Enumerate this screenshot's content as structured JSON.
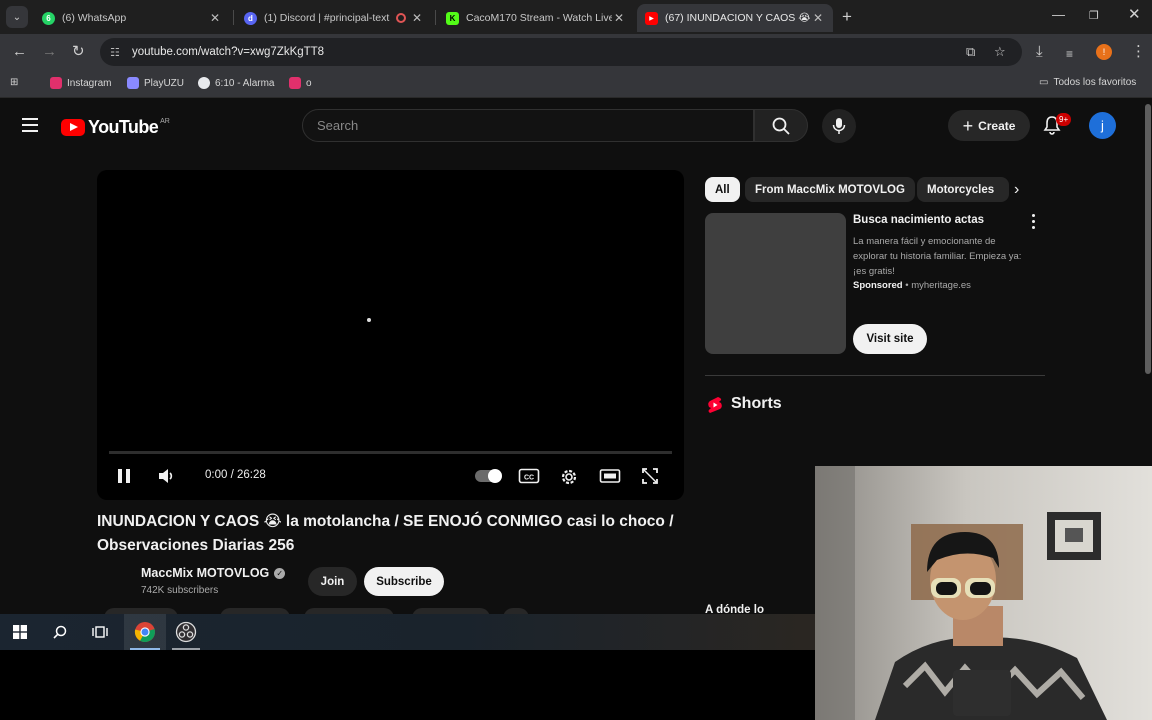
{
  "browser": {
    "tabs": [
      {
        "title": "(6) WhatsApp",
        "favicon_color": "#25d366",
        "favicon_glyph": "6",
        "active": false
      },
      {
        "title": "(1) Discord | #principal-text",
        "favicon_color": "#5865f2",
        "favicon_glyph": "d",
        "active": false
      },
      {
        "title": "CacoM170 Stream - Watch Live",
        "favicon_color": "#53fc18",
        "favicon_glyph": "K",
        "active": false
      },
      {
        "title": "(67) INUNDACION Y CAOS 😭",
        "favicon_color": "#ff0000",
        "favicon_glyph": "▶",
        "active": true
      }
    ],
    "new_tab_icon": "plus-icon",
    "url": "youtube.com/watch?v=xwg7ZkKgTT8",
    "bookmarks": [
      {
        "label": "Instagram",
        "color": "#e1306c"
      },
      {
        "label": "PlayUZU",
        "color": "#8a8aff"
      },
      {
        "label": "6:10 - Alarma",
        "color": "#e8eaed"
      },
      {
        "label": "o",
        "color": "#e1306c"
      }
    ],
    "all_bookmarks_label": "Todos los favoritos"
  },
  "youtube": {
    "logo_text": "YouTube",
    "country_code": "AR",
    "search_placeholder": "Search",
    "create_label": "Create",
    "notification_count": "9+",
    "user_initial": "j",
    "brand_red": "#ff0000"
  },
  "player": {
    "time": "0:00 / 26:28",
    "progress": 0,
    "state": "playing",
    "autoplay": "on"
  },
  "video": {
    "title": "INUNDACION Y CAOS 😭 la motolancha / SE ENOJÓ CONMIGO casi lo choco / Observaciones Diarias 256",
    "channel": "MaccMix MOTOVLOG",
    "subscribers": "742K subscribers",
    "join_label": "Join",
    "subscribe_label": "Subscribe"
  },
  "sidebar": {
    "chips": [
      "All",
      "From MaccMix MOTOVLOG",
      "Motorcycles"
    ],
    "ad": {
      "title": "Busca nacimiento actas",
      "description": "La manera fácil y emocionante de explorar tu historia familiar. Empieza ya: ¡es gratis!",
      "sponsored_label": "Sponsored",
      "domain": "myheritage.es",
      "cta": "Visit site"
    },
    "shorts_label": "Shorts",
    "cut_off_text": "A dónde lo"
  },
  "taskbar": {
    "icons": [
      "windows-start-icon",
      "search-icon",
      "task-view-icon",
      "chrome-icon",
      "obs-icon"
    ]
  }
}
